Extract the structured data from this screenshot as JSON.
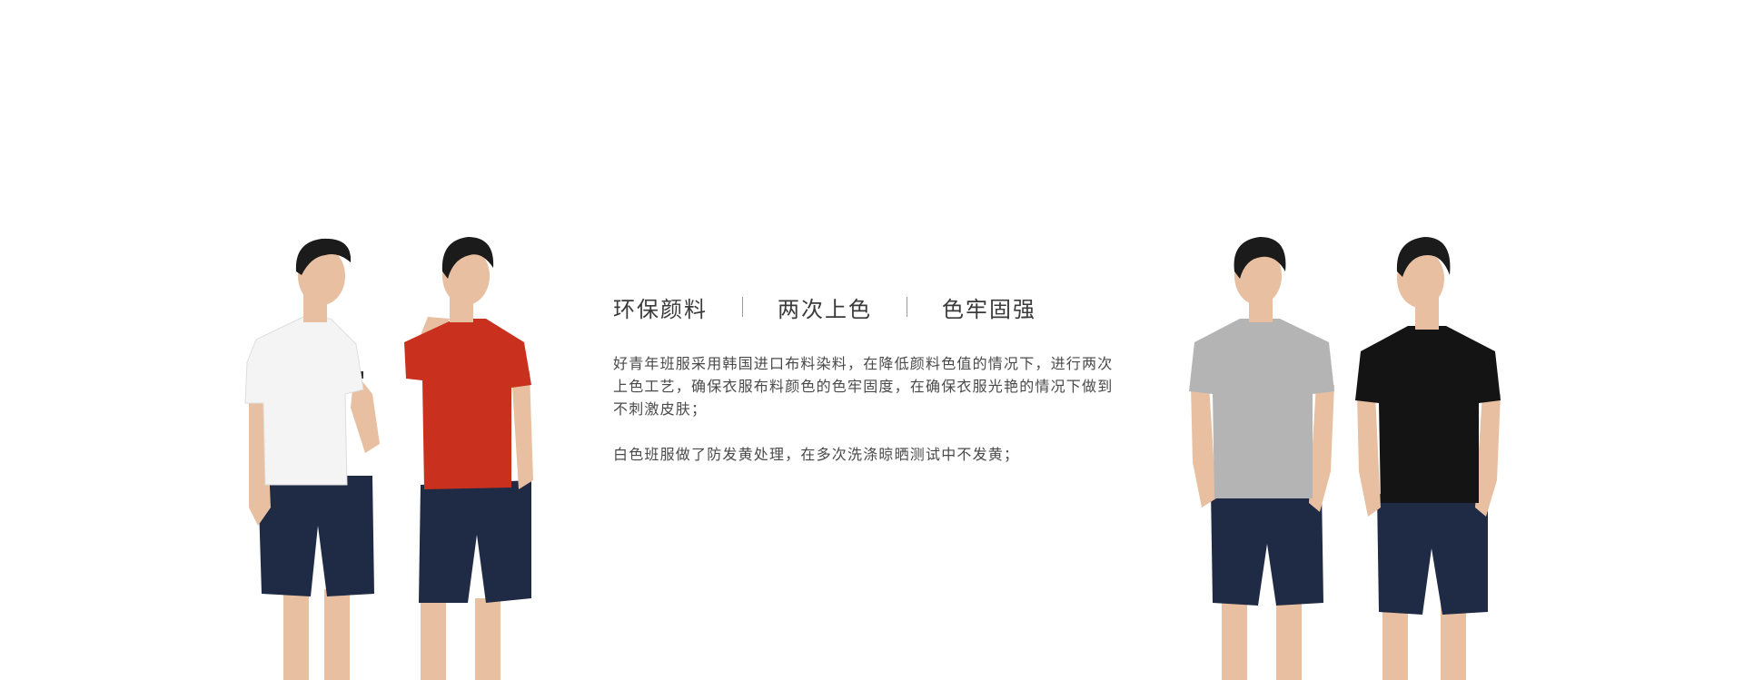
{
  "features": [
    {
      "label": "环保颜料"
    },
    {
      "label": "两次上色"
    },
    {
      "label": "色牢固强"
    }
  ],
  "description": {
    "paragraph1": "好青年班服采用韩国进口布料染料，在降低颜料色值的情况下，进行两次上色工艺，确保衣服布料颜色的色牢固度，在确保衣服光艳的情况下做到不刺激皮肤；",
    "paragraph2": "白色班服做了防发黄处理，在多次洗涤晾晒测试中不发黄；"
  },
  "models": [
    {
      "shirt_color": "#f4f4f4",
      "shorts_color": "#1f2b45"
    },
    {
      "shirt_color": "#c9301e",
      "shorts_color": "#1f2b45"
    },
    {
      "shirt_color": "#b4b4b4",
      "shorts_color": "#1f2b45"
    },
    {
      "shirt_color": "#141414",
      "shorts_color": "#1f2b45"
    }
  ],
  "colors": {
    "background": "#ffffff",
    "text": "#333333",
    "skin": "#e8bfa0",
    "hair": "#1b1b1b"
  }
}
